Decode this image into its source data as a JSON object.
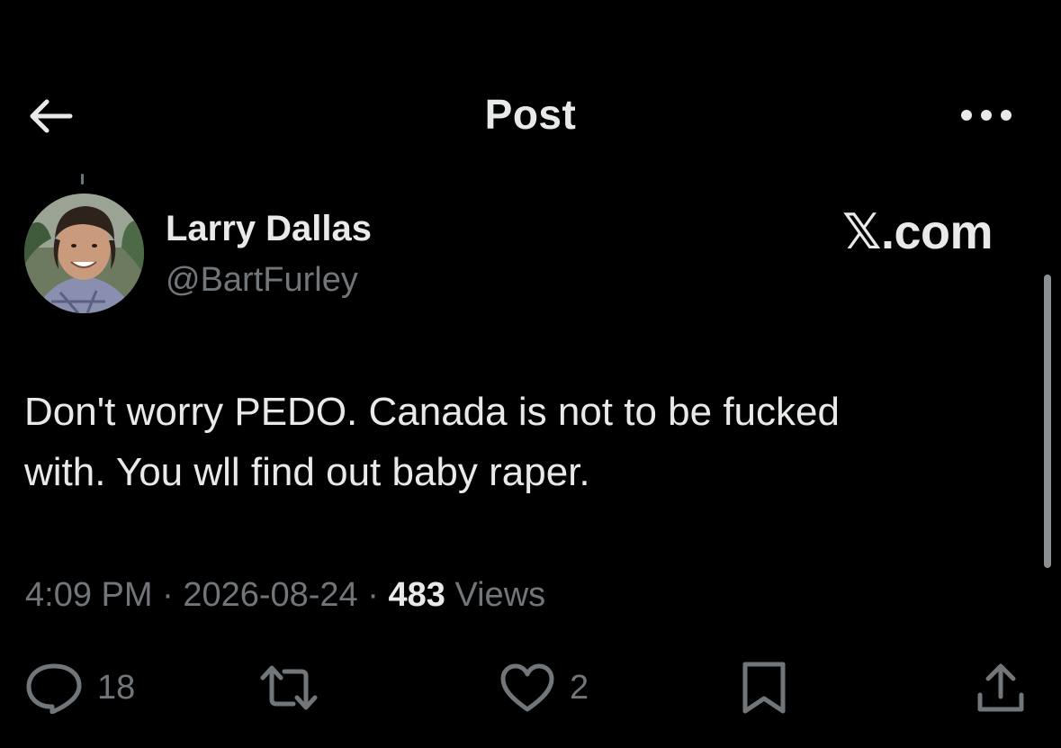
{
  "header": {
    "title": "Post",
    "back_icon": "arrow-left-icon",
    "more_icon": "more-horizontal-icon"
  },
  "author": {
    "display_name": "Larry Dallas",
    "handle": "@BartFurley"
  },
  "watermark": "𝕏.com",
  "tweet": {
    "text_line1": "Don't worry PEDO. Canada is not to be fucked",
    "text_line2": "with. You wll find out baby raper."
  },
  "meta": {
    "time": "4:09 PM",
    "separator": "·",
    "date": "2026-08-24",
    "views_count": "483",
    "views_label": "Views"
  },
  "actions": {
    "replies": "18",
    "likes": "2"
  },
  "colors": {
    "background": "#000000",
    "primary_text": "#e7e9ea",
    "secondary_text": "#71767b"
  }
}
